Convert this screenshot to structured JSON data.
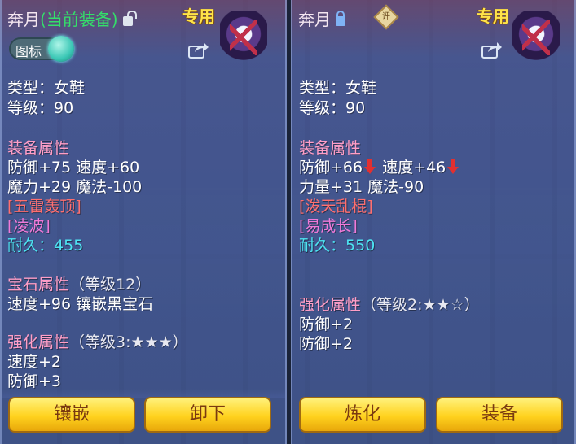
{
  "left": {
    "name": "奔月",
    "status": "(当前装备)",
    "exclusive": "专用",
    "icon_toggle_label": "图标",
    "type": "类型：女鞋",
    "level": "等级：90",
    "equip_header": "装备属性",
    "attr1": "防御+75 速度+60",
    "attr2": "魔力+29 魔法-100",
    "special_skill": "[五雷轰顶]",
    "special_effect": "[凌波]",
    "durability_label": "耐久：",
    "durability": "455",
    "gem_header": "宝石属性",
    "gem_level": "（等级12）",
    "gem_attr": "速度+96 镶嵌黑宝石",
    "enhance_header": "强化属性",
    "enhance_level": "（等级3:★★★）",
    "enhance1": "速度+2",
    "enhance2": "防御+3",
    "buttons": [
      "镶嵌",
      "卸下"
    ]
  },
  "right": {
    "name": "奔月",
    "eval_badge": "评",
    "exclusive": "专用",
    "type": "类型：女鞋",
    "level": "等级：90",
    "equip_header": "装备属性",
    "attr1_a": "防御+66",
    "attr1_b": "速度+46",
    "attr2": "力量+31 魔法-90",
    "special_skill": "[泼天乱棍]",
    "special_effect": "[易成长]",
    "durability_label": "耐久：",
    "durability": "550",
    "enhance_header": "强化属性",
    "enhance_level": "（等级2:★★☆）",
    "enhance1": "防御+2",
    "enhance2": "防御+2",
    "buttons": [
      "炼化",
      "装备"
    ]
  },
  "icons": {
    "lock_left": "unlocked-icon",
    "lock_right": "locked-icon",
    "share": "share-icon",
    "character": "character-portrait-icon",
    "stat_down": "red-down-arrow-icon"
  }
}
